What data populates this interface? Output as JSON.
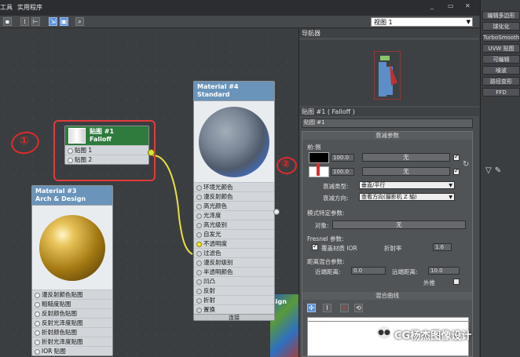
{
  "menubar": {
    "items": [
      "工具",
      "实用程序"
    ],
    "window_controls": [
      "_",
      "▭",
      "✕"
    ]
  },
  "toolbar": {
    "view_select": "视图 1"
  },
  "nodes": {
    "map": {
      "title": "贴图 #1",
      "subtitle": "Falloff",
      "slots": [
        "贴图 1",
        "贴图 2"
      ]
    },
    "arch": {
      "title": "Material #3",
      "subtitle": "Arch & Design",
      "slots": [
        "漫反射颜色贴图",
        "粗糙度贴图",
        "反射颜色贴图",
        "反射光泽度贴图",
        "折射颜色贴图",
        "折射光泽度贴图",
        "IOR 贴图"
      ]
    },
    "standard": {
      "title": "Material #4",
      "subtitle": "Standard",
      "slots": [
        "环境光颜色",
        "漫反射颜色",
        "高光颜色",
        "光泽度",
        "高光级别",
        "自发光",
        "不透明度",
        "过滤色",
        "漫反射级别",
        "半透明颜色",
        "凹凸",
        "反射",
        "折射",
        "置换"
      ],
      "footer": "连接"
    }
  },
  "annotations": {
    "mark1": "①",
    "mark2": "②"
  },
  "panel": {
    "navigator_title": "导航器",
    "map_title": "贴图 #1 ( Falloff )",
    "map_name": "贴图 #1",
    "falloff_header": "衰减参数",
    "front_side": "前:侧",
    "value1": "100.0",
    "value2": "100.0",
    "none_label": "无",
    "falloff_type_label": "衰减类型:",
    "falloff_type_value": "垂直/平行",
    "falloff_dir_label": "衰减方向:",
    "falloff_dir_value": "查看方向(摄影机 Z 轴)",
    "mode_header": "模式特定参数:",
    "object_label": "对象:",
    "fresnel_label": "Fresnel 参数:",
    "override_ior": "覆盖材质 IOR",
    "ior_label": "折射率",
    "ior_value": "1.6",
    "distance_label": "距离混合参数:",
    "near_label": "近端距离:",
    "near_value": "0.0",
    "far_label": "远端距离:",
    "far_value": "10.0",
    "extrapolate": "外推",
    "mix_curve_header": "混合曲线"
  },
  "rightcol": {
    "items": [
      "编辑多边形",
      "球化化",
      "TurboSmooth",
      "UVW 贴图",
      "可编辑",
      "噪波",
      "路径变形",
      "FFD"
    ]
  },
  "overlay": {
    "sign_fragment": "sign",
    "watermark": "CG杨杰图像设计"
  },
  "colors": {
    "node_header": "#6a94ba",
    "map_header": "#2f7a3d",
    "annotation": "#e02a2a",
    "connector": "#f0ea2a"
  }
}
